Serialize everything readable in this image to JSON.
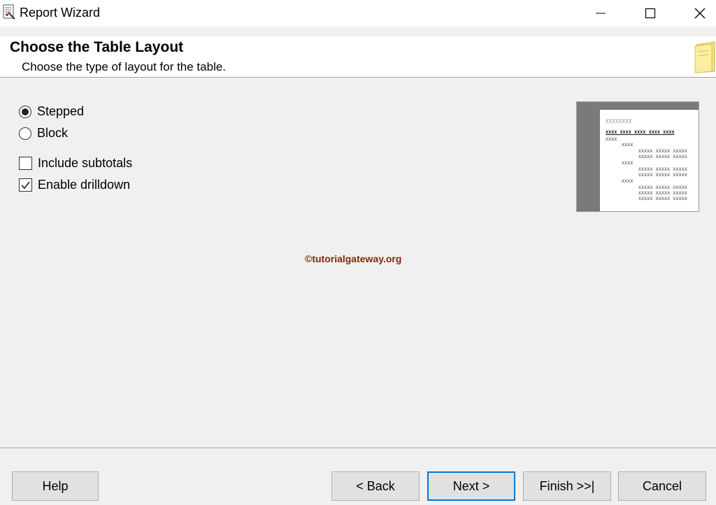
{
  "window": {
    "title": "Report Wizard",
    "minimize_icon": "minimize-icon",
    "maximize_icon": "maximize-icon",
    "close_icon": "close-icon"
  },
  "header": {
    "title": "Choose the Table Layout",
    "subtitle": "Choose the type of layout for the table.",
    "icon": "notepad-icon"
  },
  "layout_options": [
    {
      "label": "Stepped",
      "selected": true
    },
    {
      "label": "Block",
      "selected": false
    }
  ],
  "checkboxes": [
    {
      "label": "Include subtotals",
      "checked": false
    },
    {
      "label": "Enable drilldown",
      "checked": true
    }
  ],
  "preview": {
    "title": "XXXXXXXX",
    "header_row": "XXXX  XXXX  XXXX  XXXX  XXXX",
    "group1": "XXXX",
    "group2": "XXXX",
    "detail": "XXXXX  XXXXX  XXXXX"
  },
  "watermark": "©tutorialgateway.org",
  "buttons": {
    "help": "Help",
    "back": "< Back",
    "next": "Next >",
    "finish": "Finish >>|",
    "cancel": "Cancel"
  },
  "colors": {
    "accent": "#0078d7",
    "watermark": "#7a2a0a"
  }
}
